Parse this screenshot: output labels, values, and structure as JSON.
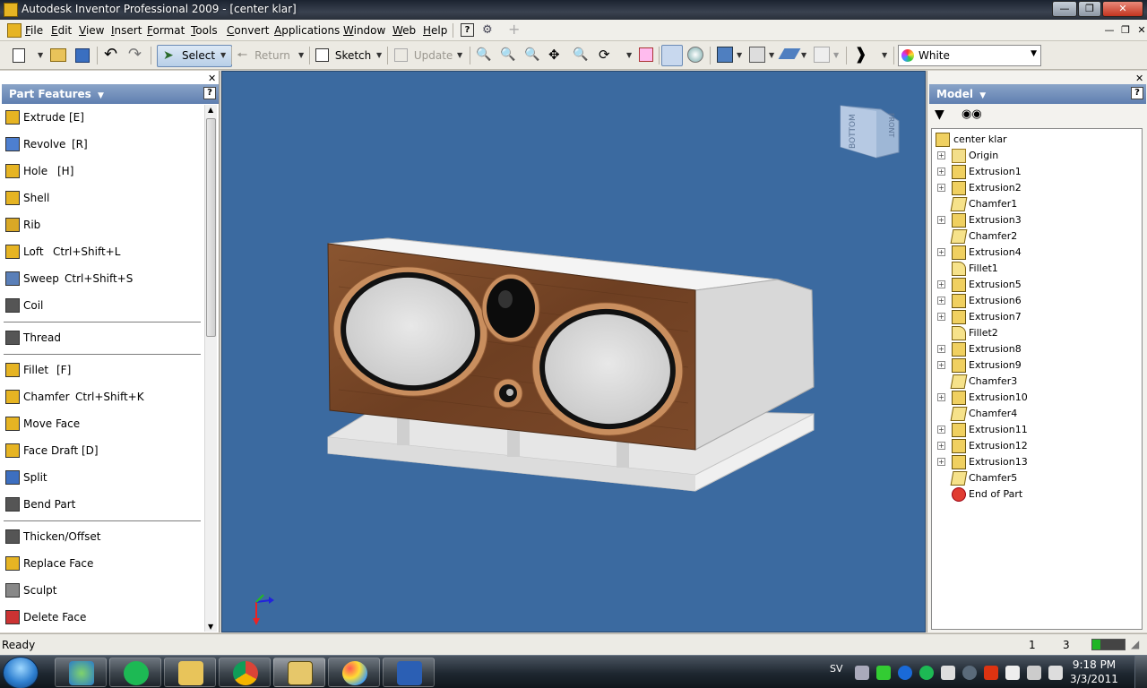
{
  "window": {
    "title": "Autodesk Inventor Professional 2009 - [center klar]"
  },
  "menu": {
    "items": [
      "File",
      "Edit",
      "View",
      "Insert",
      "Format",
      "Tools",
      "Convert",
      "Applications",
      "Window",
      "Web",
      "Help"
    ]
  },
  "toolbar": {
    "select_label": "Select",
    "return_label": "Return",
    "sketch_label": "Sketch",
    "update_label": "Update",
    "color_value": "White"
  },
  "left_panel": {
    "title": "Part Features",
    "features": [
      {
        "label": "Extrude",
        "shortcut": "[E]",
        "icon": "extrude-icon"
      },
      {
        "label": "Revolve",
        "shortcut": "[R]",
        "icon": "revolve-icon"
      },
      {
        "label": "Hole",
        "shortcut": "[H]",
        "icon": "hole-icon"
      },
      {
        "label": "Shell",
        "shortcut": "",
        "icon": "shell-icon"
      },
      {
        "label": "Rib",
        "shortcut": "",
        "icon": "rib-icon"
      },
      {
        "label": "Loft",
        "shortcut": "Ctrl+Shift+L",
        "icon": "loft-icon"
      },
      {
        "label": "Sweep",
        "shortcut": "Ctrl+Shift+S",
        "icon": "sweep-icon"
      },
      {
        "label": "Coil",
        "shortcut": "",
        "icon": "coil-icon"
      },
      {
        "label": "Thread",
        "shortcut": "",
        "icon": "thread-icon"
      },
      {
        "label": "Fillet",
        "shortcut": "[F]",
        "icon": "fillet-icon"
      },
      {
        "label": "Chamfer",
        "shortcut": "Ctrl+Shift+K",
        "icon": "chamfer-icon"
      },
      {
        "label": "Move Face",
        "shortcut": "",
        "icon": "move-face-icon"
      },
      {
        "label": "Face Draft",
        "shortcut": "[D]",
        "icon": "face-draft-icon"
      },
      {
        "label": "Split",
        "shortcut": "",
        "icon": "split-icon"
      },
      {
        "label": "Bend Part",
        "shortcut": "",
        "icon": "bend-part-icon"
      },
      {
        "label": "Thicken/Offset",
        "shortcut": "",
        "icon": "thicken-icon"
      },
      {
        "label": "Replace Face",
        "shortcut": "",
        "icon": "replace-face-icon"
      },
      {
        "label": "Sculpt",
        "shortcut": "",
        "icon": "sculpt-icon"
      },
      {
        "label": "Delete Face",
        "shortcut": "",
        "icon": "delete-face-icon"
      }
    ]
  },
  "viewcube": {
    "face_bottom": "BOTTOM",
    "face_front": "FRONT"
  },
  "right_panel": {
    "title": "Model",
    "root": "center klar",
    "nodes": [
      {
        "label": "Origin",
        "kind": "folder",
        "expandable": true
      },
      {
        "label": "Extrusion1",
        "kind": "extrusion",
        "expandable": true
      },
      {
        "label": "Extrusion2",
        "kind": "extrusion",
        "expandable": true
      },
      {
        "label": "Chamfer1",
        "kind": "chamfer",
        "expandable": false
      },
      {
        "label": "Extrusion3",
        "kind": "extrusion",
        "expandable": true
      },
      {
        "label": "Chamfer2",
        "kind": "chamfer",
        "expandable": false
      },
      {
        "label": "Extrusion4",
        "kind": "extrusion",
        "expandable": true
      },
      {
        "label": "Fillet1",
        "kind": "fillet",
        "expandable": false
      },
      {
        "label": "Extrusion5",
        "kind": "extrusion",
        "expandable": true
      },
      {
        "label": "Extrusion6",
        "kind": "extrusion",
        "expandable": true
      },
      {
        "label": "Extrusion7",
        "kind": "extrusion",
        "expandable": true
      },
      {
        "label": "Fillet2",
        "kind": "fillet",
        "expandable": false
      },
      {
        "label": "Extrusion8",
        "kind": "extrusion",
        "expandable": true
      },
      {
        "label": "Extrusion9",
        "kind": "extrusion",
        "expandable": true
      },
      {
        "label": "Chamfer3",
        "kind": "chamfer",
        "expandable": false
      },
      {
        "label": "Extrusion10",
        "kind": "extrusion",
        "expandable": true
      },
      {
        "label": "Chamfer4",
        "kind": "chamfer",
        "expandable": false
      },
      {
        "label": "Extrusion11",
        "kind": "extrusion",
        "expandable": true
      },
      {
        "label": "Extrusion12",
        "kind": "extrusion",
        "expandable": true
      },
      {
        "label": "Extrusion13",
        "kind": "extrusion",
        "expandable": true
      },
      {
        "label": "Chamfer5",
        "kind": "chamfer",
        "expandable": false
      },
      {
        "label": "End of Part",
        "kind": "end",
        "expandable": false
      }
    ]
  },
  "status": {
    "text": "Ready",
    "count_a": "1",
    "count_b": "3"
  },
  "taskbar": {
    "language": "SV",
    "time": "9:18 PM",
    "date": "3/3/2011",
    "apps": [
      "windows-live-messenger-icon",
      "spotify-icon",
      "file-explorer-icon",
      "chrome-icon",
      "inventor-pro-icon",
      "paint-icon",
      "word-icon"
    ]
  },
  "colors": {
    "viewport_bg": "#3b6aa0",
    "wood": "#7a4a2a",
    "panel_header": "#6f8dba"
  }
}
